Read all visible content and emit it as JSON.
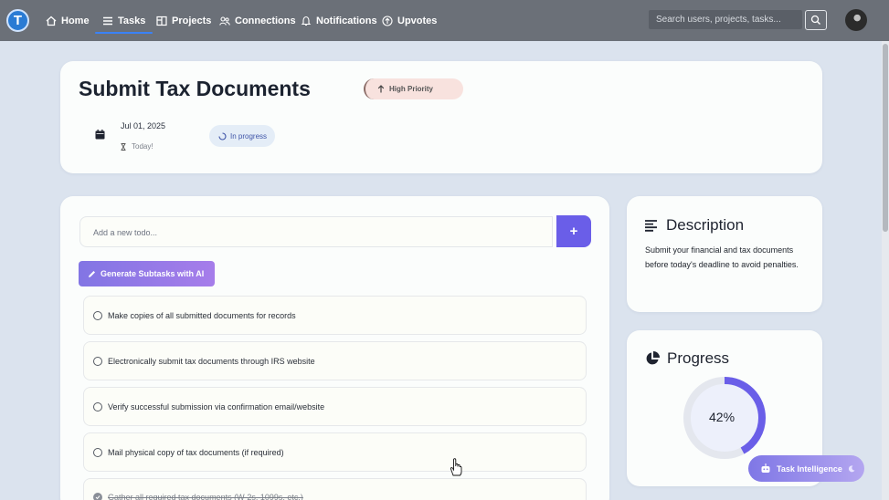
{
  "nav": {
    "logo_letter": "T",
    "items": [
      {
        "label": "Home",
        "icon": "home-icon"
      },
      {
        "label": "Tasks",
        "icon": "list-icon",
        "active": true
      },
      {
        "label": "Projects",
        "icon": "board-icon"
      },
      {
        "label": "Connections",
        "icon": "users-icon"
      },
      {
        "label": "Notifications",
        "icon": "bell-icon"
      },
      {
        "label": "Upvotes",
        "icon": "arrow-up-circle-icon"
      }
    ],
    "search_placeholder": "Search users, projects, tasks...",
    "accent_color": "#3b82f6"
  },
  "task": {
    "title": "Submit Tax Documents",
    "priority": "High Priority",
    "date": "Jul 01, 2025",
    "due_note": "Today!",
    "status": "In progress"
  },
  "todo": {
    "input_placeholder": "Add a new todo...",
    "add_label": "+",
    "ai_button": "Generate Subtasks with AI",
    "items": [
      {
        "text": "Make copies of all submitted documents for records",
        "done": false
      },
      {
        "text": "Electronically submit tax documents through IRS website",
        "done": false
      },
      {
        "text": "Verify successful submission via confirmation email/website",
        "done": false
      },
      {
        "text": "Mail physical copy of tax documents (if required)",
        "done": false
      },
      {
        "text": "Gather all required tax documents (W-2s, 1099s, etc.)",
        "done": true
      }
    ]
  },
  "description": {
    "heading": "Description",
    "text": "Submit your financial and tax documents before today's deadline to avoid penalties."
  },
  "progress": {
    "heading": "Progress",
    "value_label": "42%",
    "fraction": 0.42,
    "color": "#6a5ee8"
  },
  "assistant": {
    "label": "Task Intelligence"
  }
}
